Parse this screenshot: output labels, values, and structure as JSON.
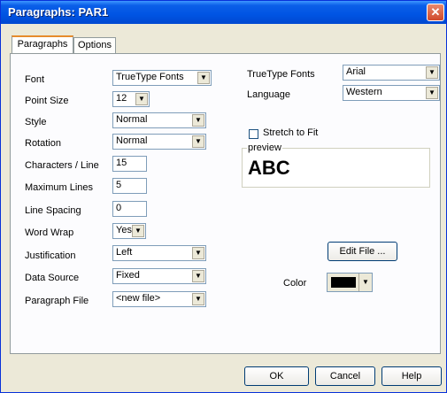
{
  "window": {
    "title": "Paragraphs: PAR1",
    "close_glyph": "✕"
  },
  "tabs": [
    {
      "label": "Paragraphs"
    },
    {
      "label": "Options"
    }
  ],
  "left": {
    "font": {
      "label": "Font",
      "value": "TrueType Fonts"
    },
    "point_size": {
      "label": "Point Size",
      "value": "12"
    },
    "style": {
      "label": "Style",
      "value": "Normal"
    },
    "rotation": {
      "label": "Rotation",
      "value": "Normal"
    },
    "chars_per_line": {
      "label": "Characters / Line",
      "value": "15"
    },
    "max_lines": {
      "label": "Maximum Lines",
      "value": "5"
    },
    "line_spacing": {
      "label": "Line Spacing",
      "value": "0"
    },
    "word_wrap": {
      "label": "Word Wrap",
      "value": "Yes"
    },
    "justification": {
      "label": "Justification",
      "value": "Left"
    },
    "data_source": {
      "label": "Data Source",
      "value": "Fixed"
    },
    "paragraph_file": {
      "label": "Paragraph File",
      "value": "<new file>"
    }
  },
  "right": {
    "truetype_fonts": {
      "label": "TrueType Fonts",
      "value": "Arial"
    },
    "language": {
      "label": "Language",
      "value": "Western"
    },
    "stretch": {
      "label": "Stretch to Fit",
      "checked": false
    },
    "preview": {
      "legend": "preview",
      "text": "ABC"
    },
    "edit_file_label": "Edit File ...",
    "color": {
      "label": "Color",
      "value_hex": "#000000"
    }
  },
  "buttons": {
    "ok": "OK",
    "cancel": "Cancel",
    "help": "Help"
  },
  "icons": {
    "dropdown_arrow": "▼"
  }
}
